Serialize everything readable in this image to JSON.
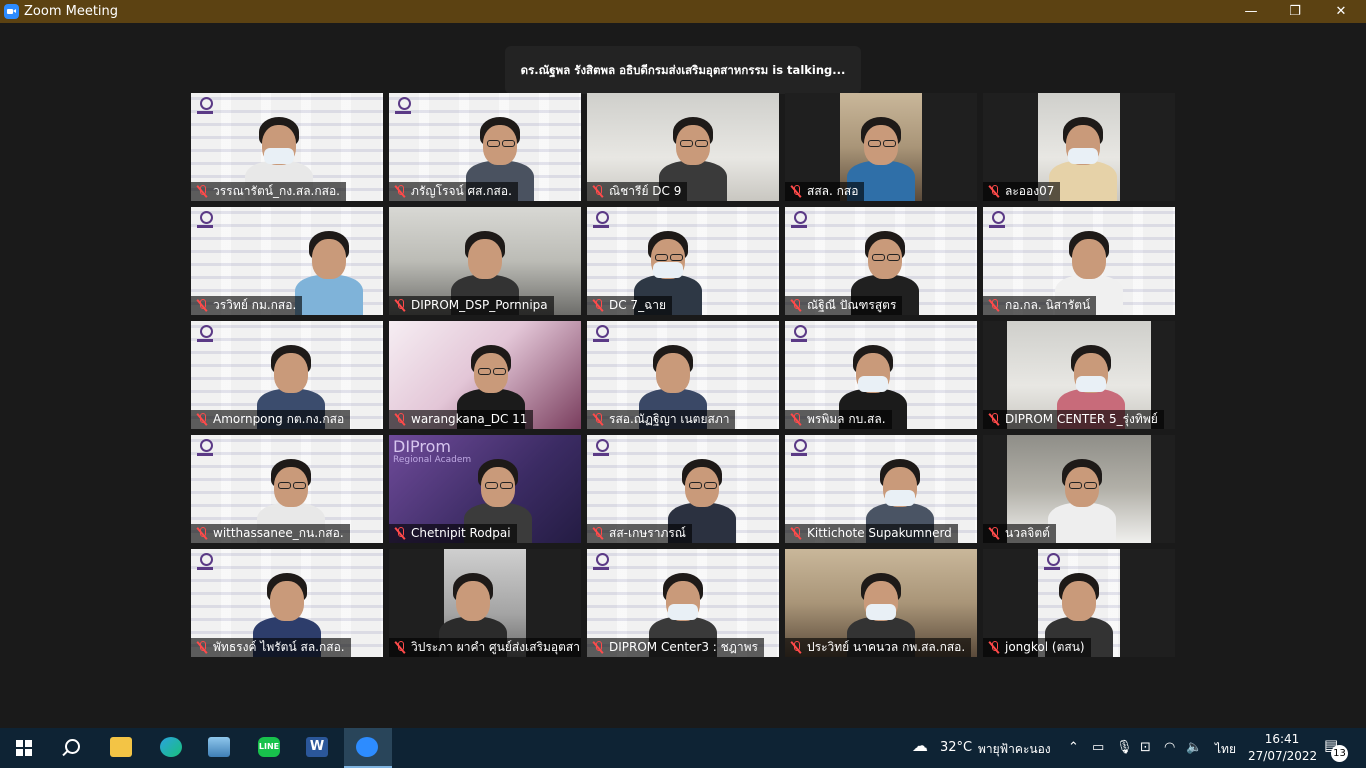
{
  "window": {
    "title": "Zoom Meeting",
    "controls": {
      "minimize": "—",
      "restore": "❐",
      "close": "✕"
    }
  },
  "meeting": {
    "talking_banner": "ดร.ณัฐพล รังสิตพล อธิบดีกรมส่งเสริมอุตสาหกรรม is talking..."
  },
  "participants": [
    {
      "name": "วรรณารัตน์_กง.สล.กสอ.",
      "muted": true,
      "bg": "dip"
    },
    {
      "name": "ภรัญโรจน์ ศส.กสอ.",
      "muted": true,
      "bg": "dip"
    },
    {
      "name": "ณิชารีย์ DC 9",
      "muted": true,
      "bg": "wall"
    },
    {
      "name": "สสล. กสอ",
      "muted": true,
      "bg": "room"
    },
    {
      "name": "ละออง07",
      "muted": true,
      "bg": "wall"
    },
    {
      "name": "วรวิทย์ กม.กสอ.",
      "muted": true,
      "bg": "dip"
    },
    {
      "name": "DIPROM_DSP_Pornnipa",
      "muted": true,
      "bg": "office"
    },
    {
      "name": "DC 7_ฉาย",
      "muted": true,
      "bg": "dip"
    },
    {
      "name": "ณัฐิณี ปัณฑรสูตร",
      "muted": true,
      "bg": "dip"
    },
    {
      "name": "กอ.กล. นิสารัตน์",
      "muted": true,
      "bg": "dip"
    },
    {
      "name": "Amornpong กต.กง.กสอ",
      "muted": true,
      "bg": "dip"
    },
    {
      "name": "warangkana_DC 11",
      "muted": true,
      "bg": "pink"
    },
    {
      "name": "รสอ.ณัฏฐิญา เนตยสภา",
      "muted": true,
      "bg": "dip"
    },
    {
      "name": "พรพิมล กบ.สล.",
      "muted": true,
      "bg": "dip"
    },
    {
      "name": "DIPROM CENTER 5_รุ่งทิพย์",
      "muted": true,
      "bg": "wall"
    },
    {
      "name": "witthassanee_กน.กสอ.",
      "muted": true,
      "bg": "dip"
    },
    {
      "name": "Chetnipit Rodpai",
      "muted": true,
      "bg": "purple"
    },
    {
      "name": "สส-เกษราภรณ์",
      "muted": true,
      "bg": "dip"
    },
    {
      "name": "Kittichote Supakumnerd",
      "muted": true,
      "bg": "dip"
    },
    {
      "name": "นวลจิตต์",
      "muted": true,
      "bg": "stone"
    },
    {
      "name": "พัทธรงค์ ไพรัตน์ สล.กสอ.",
      "muted": true,
      "bg": "dip"
    },
    {
      "name": "วิประภา ผาคำ ศูนย์ส่งเสริมอุตสา...",
      "muted": true,
      "bg": "car"
    },
    {
      "name": "DIPROM Center3 : ชฎาพร",
      "muted": true,
      "bg": "dip"
    },
    {
      "name": "ประวิทย์ นาคนวล กพ.สล.กสอ.",
      "muted": true,
      "bg": "room"
    },
    {
      "name": "jongkol (ตสน)",
      "muted": true,
      "bg": "dip"
    }
  ],
  "tile_texts": {
    "purple_brand": "DIProm",
    "purple_sub": "Regional Academ"
  },
  "taskbar": {
    "apps": [
      {
        "icon": "start-icon"
      },
      {
        "icon": "search-icon"
      },
      {
        "icon": "file-explorer-icon",
        "color": "#f3c445"
      },
      {
        "icon": "edge-icon",
        "color": "#2aa3e0"
      },
      {
        "icon": "photos-icon",
        "color": "#5aa7d8"
      },
      {
        "icon": "line-icon",
        "color": "#18c24c",
        "label": "LINE"
      },
      {
        "icon": "word-icon",
        "color": "#2b579a",
        "label": "W"
      },
      {
        "icon": "zoom-icon",
        "color": "#2d8cff",
        "active": true
      }
    ],
    "weather": {
      "temp": "32°C",
      "text": "พายุฟ้าคะนอง"
    },
    "language": "ไทย",
    "time": "16:41",
    "date": "27/07/2022",
    "notifications": "13"
  }
}
